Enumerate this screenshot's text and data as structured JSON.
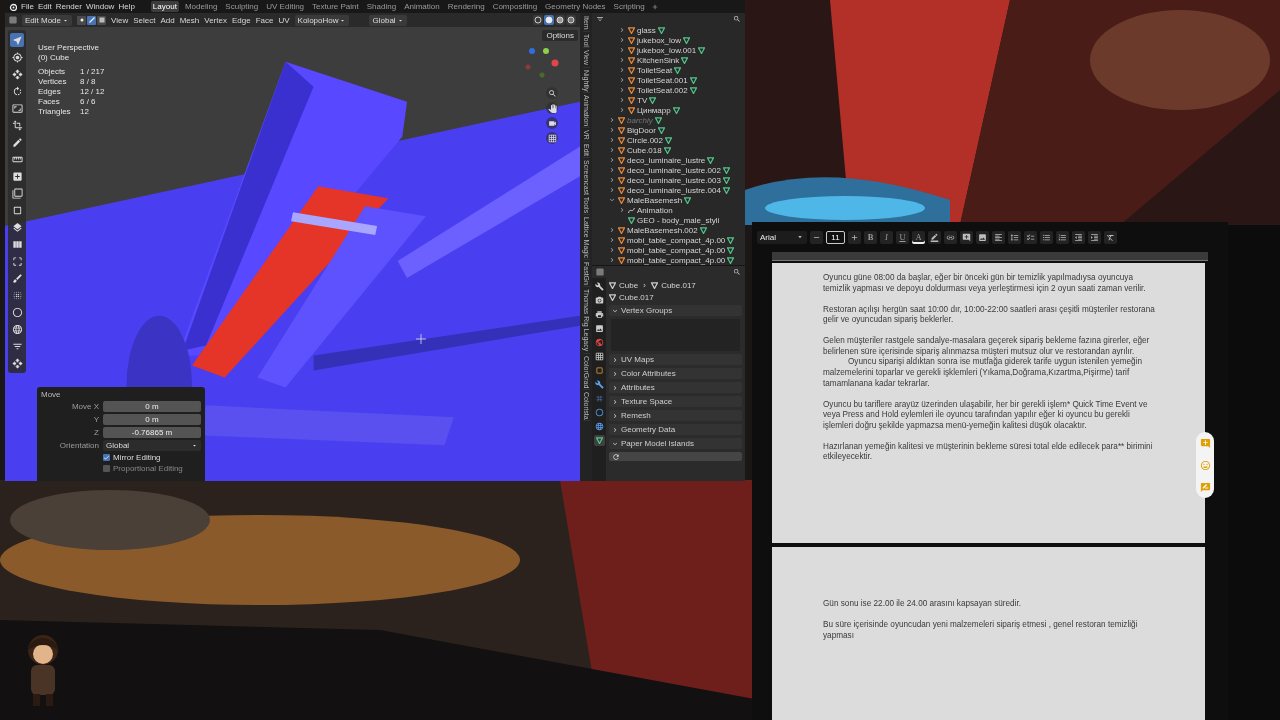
{
  "blender": {
    "menu": [
      "File",
      "Edit",
      "Render",
      "Window",
      "Help"
    ],
    "workspaces": [
      {
        "label": "Layout",
        "selected": true
      },
      {
        "label": "Modeling",
        "selected": false
      },
      {
        "label": "Sculpting",
        "selected": false
      },
      {
        "label": "UV Editing",
        "selected": false
      },
      {
        "label": "Texture Paint",
        "selected": false
      },
      {
        "label": "Shading",
        "selected": false
      },
      {
        "label": "Animation",
        "selected": false
      },
      {
        "label": "Rendering",
        "selected": false
      },
      {
        "label": "Compositing",
        "selected": false
      },
      {
        "label": "Geometry Nodes",
        "selected": false
      },
      {
        "label": "Scripting",
        "selected": false
      }
    ],
    "header": {
      "mode": "Edit Mode",
      "select_modes": [
        {
          "kind": "vertex",
          "selected": false
        },
        {
          "kind": "edge",
          "selected": true
        },
        {
          "kind": "face",
          "selected": false
        }
      ],
      "menus": [
        "View",
        "Select",
        "Add",
        "Mesh",
        "Vertex",
        "Edge",
        "Face",
        "UV"
      ],
      "uv_addon": "KolopoHow",
      "orientation": "Global",
      "shading": [
        {
          "kind": "wireframe",
          "selected": false
        },
        {
          "kind": "solid",
          "selected": true
        },
        {
          "kind": "material",
          "selected": false
        },
        {
          "kind": "rendered",
          "selected": false
        }
      ]
    },
    "viewport": {
      "view_name": "User Perspective",
      "object_name": "(0) Cube",
      "options": "Options",
      "stats": [
        {
          "label": "Objects",
          "value": "1 / 217"
        },
        {
          "label": "Vertices",
          "value": "8 / 8"
        },
        {
          "label": "Edges",
          "value": "12 / 12"
        },
        {
          "label": "Faces",
          "value": "6 / 6"
        },
        {
          "label": "Triangles",
          "value": "12"
        }
      ]
    },
    "sidebar_tabs": [
      "Item",
      "Tool",
      "View",
      "Nightly",
      "Animation",
      "VR",
      "Edit",
      "Screencast Tools",
      "Lattice Magic",
      "FastGn",
      "Thomas Rig Legacy",
      "ColorGrad",
      "Colorista"
    ],
    "outliner": {
      "items": [
        {
          "children": [
            {
              "name": "glass",
              "kind": "mesh",
              "expanded": false
            },
            {
              "name": "jukebox_low",
              "kind": "mesh",
              "expanded": false
            },
            {
              "name": "jukebox_low.001",
              "kind": "mesh",
              "expanded": false
            },
            {
              "name": "KitchenSink",
              "kind": "mesh",
              "expanded": false
            },
            {
              "name": "ToiletSeat",
              "kind": "mesh",
              "expanded": false
            },
            {
              "name": "ToiletSeat.001",
              "kind": "mesh",
              "expanded": false
            },
            {
              "name": "ToiletSeat.002",
              "kind": "mesh",
              "expanded": false
            },
            {
              "name": "TV",
              "kind": "mesh",
              "expanded": false
            },
            {
              "name": "Цинмарр",
              "kind": "mesh",
              "expanded": false
            }
          ]
        },
        {
          "name": "barchiy",
          "kind": "mesh",
          "expanded": false,
          "dimmed": true
        },
        {
          "name": "BigDoor",
          "kind": "mesh",
          "expanded": false
        },
        {
          "name": "Circle.002",
          "kind": "mesh",
          "expanded": false
        },
        {
          "name": "Cube.018",
          "kind": "mesh",
          "expanded": false
        },
        {
          "name": "deco_luminaire_lustre",
          "kind": "mesh",
          "expanded": false
        },
        {
          "name": "deco_luminaire_lustre.002",
          "kind": "mesh",
          "expanded": false
        },
        {
          "name": "deco_luminaire_lustre.003",
          "kind": "mesh",
          "expanded": false
        },
        {
          "name": "deco_luminaire_lustre.004",
          "kind": "mesh",
          "expanded": false
        },
        {
          "name": "MaleBasemesh",
          "kind": "mesh",
          "expanded": true,
          "children": [
            {
              "name": "Animation",
              "kind": "animation",
              "expanded": false
            },
            {
              "name": "GEO - body_male_styli",
              "kind": "mesh_data"
            }
          ]
        },
        {
          "name": "MaleBasemesh.002",
          "kind": "mesh",
          "expanded": false
        },
        {
          "name": "mobi_table_compact_4p.00",
          "kind": "mesh",
          "expanded": false
        },
        {
          "name": "mobi_table_compact_4p.00",
          "kind": "mesh",
          "expanded": false
        },
        {
          "name": "mobi_table_compact_4p.00",
          "kind": "mesh",
          "expanded": false
        }
      ]
    },
    "properties": {
      "path": [
        "Cube",
        "Cube.017"
      ],
      "data_name": "Cube.017",
      "panels": [
        {
          "label": "Vertex Groups",
          "kind": "list",
          "expanded": true
        },
        {
          "label": "UV Maps",
          "expanded": false
        },
        {
          "label": "Color Attributes",
          "expanded": false
        },
        {
          "label": "Attributes",
          "expanded": false
        },
        {
          "label": "Texture Space",
          "expanded": false
        },
        {
          "label": "Remesh",
          "expanded": false
        },
        {
          "label": "Geometry Data",
          "expanded": false
        },
        {
          "label": "Paper Model Islands",
          "kind": "refresh",
          "expanded": true
        }
      ]
    },
    "operator_panel": {
      "title": "Move",
      "fields": [
        {
          "label": "Move X",
          "value": "0 m"
        },
        {
          "label": "Y",
          "value": "0 m"
        },
        {
          "label": "Z",
          "value": "-0.76865 m"
        }
      ],
      "orientation_label": "Orientation",
      "orientation": "Global",
      "options": [
        {
          "label": "Mirror Editing",
          "checked": true
        },
        {
          "label": "Proportional Editing",
          "checked": false
        }
      ]
    }
  },
  "document": {
    "toolbar": {
      "font": "Arial",
      "font_size": "11",
      "format_buttons": [
        {
          "label": "B",
          "kind": "bold"
        },
        {
          "label": "I",
          "kind": "italic"
        },
        {
          "label": "U",
          "kind": "underline"
        },
        {
          "label": "A",
          "kind": "color"
        }
      ]
    },
    "pages": [
      {
        "paragraphs": [
          {
            "text": "Oyuncu güne 08:00 da başlar, eğer bir önceki gün bir temizlik yapılmadıysa oyuncuya temizlik yapması ve depoyu doldurması veya yerleştirmesi için 2 oyun saati zaman verilir.",
            "indented": false
          },
          {
            "text": "Restoran açılışı hergün saat 10:00 dır, 10:00-22:00 saatleri arası çeşitli müşteriler restorana gelir ve oyuncudan sipariş beklerler.",
            "indented": false
          },
          {
            "text": "Gelen müşteriler rastgele sandalye-masalara geçerek sipariş bekleme fazına girerler, eğer belirlenen süre içerisinde sipariş alınmazsa müşteri mutsuz olur ve restorandan ayrılır.",
            "indented": false
          },
          {
            "text": "Oyuncu siparişi aldıktan sonra ise mutfağa giderek tarife uygun istenilen yemeğin malzemelerini toparlar ve gerekli işklemleri (Yıkama,Doğrama,Kızartma,Pişirme) tarif tamamlanana kadar tekrarlar.",
            "indented": true
          },
          {
            "text": "Oyuncu bu tariflere arayüz üzerinden ulaşabilir, her bir gerekli işlem* Quick Time Event ve veya Press and Hold eylemleri ile oyuncu tarafından yapılır eğer ki oyuncu bu gerekli işlemleri doğru şekilde yapmazsa  menü-yemeğin kalitesi düşük olacaktır.",
            "indented": false
          },
          {
            "text": "Hazırlanan yemeğin kalitesi ve müşterinin bekleme süresi total elde edilecek para** birimini etkileyecektir.",
            "indented": false
          }
        ]
      },
      {
        "paragraphs": [
          {
            "text": "Gün sonu ise 22.00 ile 24.00 arasını kapsayan süredir.",
            "indented": false
          },
          {
            "text": "Bu süre içerisinde oyuncudan yeni malzemeleri sipariş etmesi , genel restoran temizliği yapması",
            "indented": false
          }
        ]
      }
    ]
  }
}
